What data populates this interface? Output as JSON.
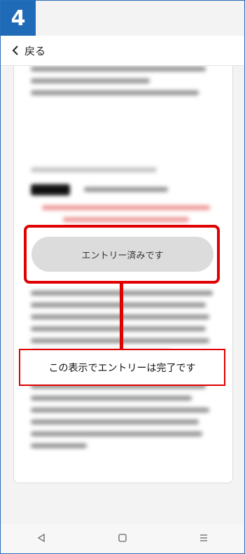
{
  "step": {
    "number": "4"
  },
  "header": {
    "back_label": "戻る"
  },
  "main": {
    "entry_button_label": "エントリー済みです"
  },
  "annotation": {
    "callout_text": "この表示でエントリーは完了です"
  },
  "icons": {
    "back": "chevron-left-icon",
    "nav_back": "triangle-back-icon",
    "nav_home": "square-home-icon",
    "nav_menu": "menu-lines-icon"
  },
  "colors": {
    "badge": "#1f6bb8",
    "highlight": "#e00000",
    "button_bg": "#dcdcdc"
  }
}
